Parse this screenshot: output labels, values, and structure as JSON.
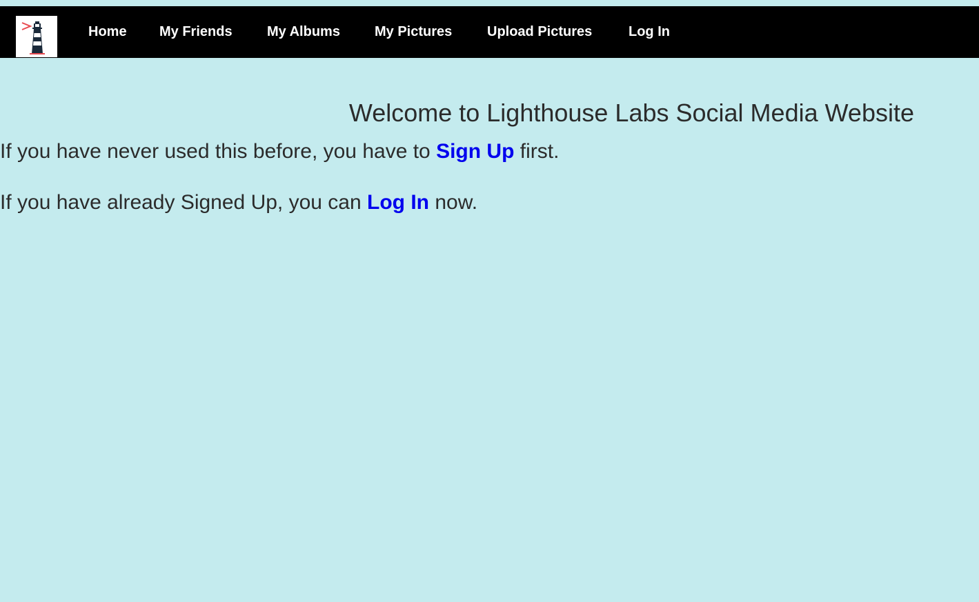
{
  "nav": {
    "logo_alt": "Lighthouse Labs logo",
    "items": [
      {
        "label": "Home"
      },
      {
        "label": "My Friends"
      },
      {
        "label": "My Albums"
      },
      {
        "label": "My Pictures"
      },
      {
        "label": "Upload Pictures"
      },
      {
        "label": "Log In"
      }
    ]
  },
  "main": {
    "welcome": "Welcome to Lighthouse Labs Social Media Website",
    "signup_para": {
      "before": "If you have never used this before, you have to ",
      "link": "Sign Up",
      "after": " first."
    },
    "login_para": {
      "before": "If you have already Signed Up, you can ",
      "link": "Log In",
      "after": " now."
    }
  },
  "colors": {
    "background": "#c4ebee",
    "navbar": "#000000",
    "nav_text": "#ffffff",
    "link": "#0000ee",
    "body_text": "#2b2b2b",
    "logo_accent": "#e8494f"
  }
}
